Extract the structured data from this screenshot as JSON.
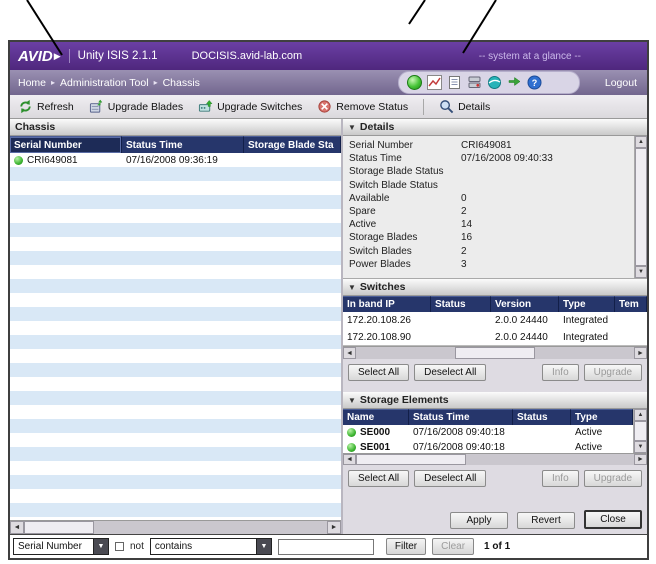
{
  "glyphs": {
    "logo_mark": "▶",
    "collapse": "▼",
    "crumb_sep": "▸",
    "dropdown": "▼",
    "left": "◄",
    "right": "►",
    "up": "▲",
    "down": "▼",
    "help": "?"
  },
  "titlebar": {
    "logo": "AVID",
    "product": "Unity ISIS 2.1.1",
    "host": "DOCISIS.avid-lab.com",
    "glance": "-- system at a glance --"
  },
  "navbar": {
    "breadcrumb": [
      "Home",
      "Administration Tool",
      "Chassis"
    ],
    "logout": "Logout",
    "tray_icons": [
      "status-led",
      "performance-chart-icon",
      "log-document-icon",
      "storage-server-icon",
      "network-globe-icon",
      "transfer-icon",
      "help-icon"
    ]
  },
  "toolbar": {
    "items": [
      "Refresh",
      "Upgrade Blades",
      "Upgrade Switches",
      "Remove Status",
      "Details"
    ]
  },
  "chassis": {
    "title": "Chassis",
    "columns": [
      "Serial Number",
      "Status Time",
      "Storage Blade Sta"
    ],
    "rows": [
      {
        "serial": "CRI649081",
        "status_time": "07/16/2008 09:36:19",
        "led": "green"
      }
    ]
  },
  "details": {
    "title": "Details",
    "fields": [
      {
        "label": "Serial Number",
        "value": "CRI649081"
      },
      {
        "label": "Status Time",
        "value": "07/16/2008 09:40:33"
      },
      {
        "label": "Storage Blade Status",
        "value": ""
      },
      {
        "label": "Switch Blade Status",
        "value": ""
      },
      {
        "label": "Available",
        "value": "0"
      },
      {
        "label": "Spare",
        "value": "2"
      },
      {
        "label": "Active",
        "value": "14"
      },
      {
        "label": "Storage Blades",
        "value": "16"
      },
      {
        "label": "Switch Blades",
        "value": "2"
      },
      {
        "label": "Power Blades",
        "value": "3"
      }
    ]
  },
  "switches": {
    "title": "Switches",
    "columns": [
      "In band IP",
      "Status",
      "Version",
      "Type",
      "Tem"
    ],
    "rows": [
      {
        "ip": "172.20.108.26",
        "status": "",
        "version": "2.0.0 24440",
        "type": "Integrated"
      },
      {
        "ip": "172.20.108.90",
        "status": "",
        "version": "2.0.0 24440",
        "type": "Integrated"
      }
    ],
    "buttons": {
      "select_all": "Select All",
      "deselect_all": "Deselect All",
      "info": "Info",
      "upgrade": "Upgrade"
    }
  },
  "storage": {
    "title": "Storage Elements",
    "columns": [
      "Name",
      "Status Time",
      "Status",
      "Type"
    ],
    "rows": [
      {
        "name": "SE000",
        "status_time": "07/16/2008 09:40:18",
        "status": "",
        "type": "Active",
        "led": "green"
      },
      {
        "name": "SE001",
        "status_time": "07/16/2008 09:40:18",
        "status": "",
        "type": "Active",
        "led": "green"
      }
    ],
    "buttons": {
      "select_all": "Select All",
      "deselect_all": "Deselect All",
      "info": "Info",
      "upgrade": "Upgrade"
    }
  },
  "actions": {
    "apply": "Apply",
    "revert": "Revert",
    "close": "Close"
  },
  "filter": {
    "field": "Serial Number",
    "not_label": "not",
    "operator": "contains",
    "value": "",
    "filter_button": "Filter",
    "clear_button": "Clear",
    "count": "1 of 1"
  },
  "colors": {
    "brand_purple": "#5b2f91",
    "navbar_lavender": "#8c81a8",
    "table_header_navy": "#26366b",
    "row_alt_blue": "#d9e8f6",
    "led_green": "#3fbf2f",
    "section_gray": "#dedbe2"
  }
}
